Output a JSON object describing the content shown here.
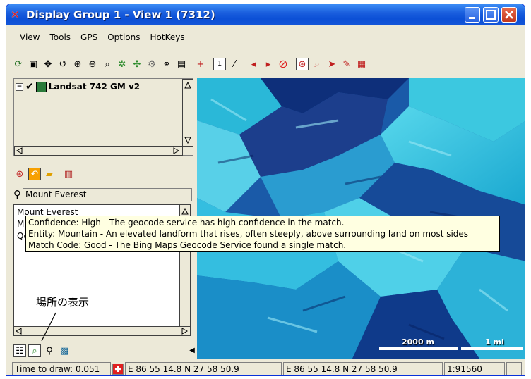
{
  "window": {
    "title": "Display Group 1 - View 1 (7312)"
  },
  "menu": {
    "items": [
      "View",
      "Tools",
      "GPS",
      "Options",
      "HotKeys"
    ]
  },
  "layers": {
    "name": "Landsat 742 GM v2"
  },
  "search": {
    "value": "Mount Everest"
  },
  "results": {
    "items": [
      "Mount Everest",
      "Mo",
      "Qo"
    ]
  },
  "tooltip": {
    "lines": [
      "Confidence: High - The geocode service has high confidence in the match.",
      "Entity: Mountain - An elevated landform that rises, often steeply, above surrounding land on most sides",
      "Match Code: Good - The Bing Maps Geocode Service found a single match."
    ]
  },
  "annotation": {
    "label": "場所の表示"
  },
  "scale": {
    "metric": "2000 m",
    "imperial": "1 mi"
  },
  "status": {
    "time_to_draw": "Time to draw: 0.051",
    "coord_1": "E 86 55 14.8  N 27 58 50.9",
    "coord_2": "E 86 55 14.8  N 27 58 50.9",
    "scale": "1:91560"
  },
  "colors": {
    "title_bar": "#0b4fd6",
    "tooltip_bg": "#ffffe1",
    "map_cyan": "#29c6e0",
    "map_dark": "#0a2a7a"
  }
}
